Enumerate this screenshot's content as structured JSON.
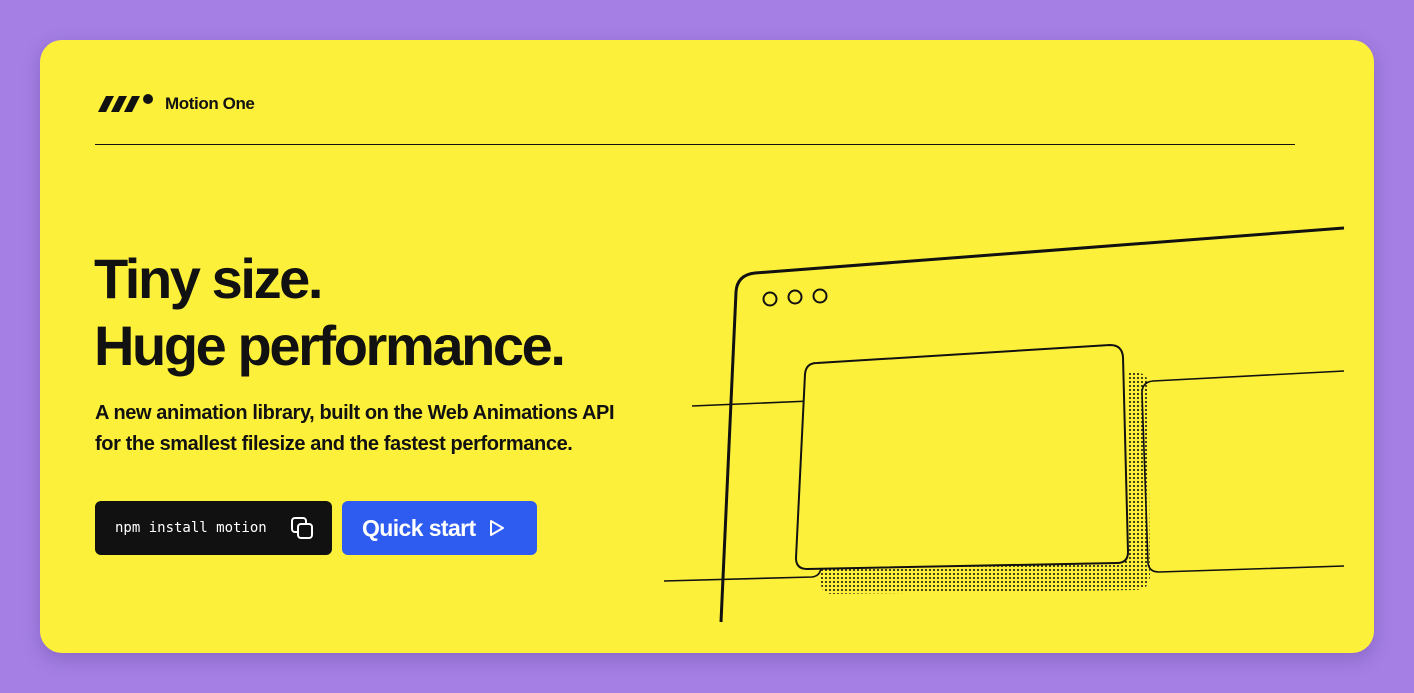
{
  "brand": {
    "name": "Motion One",
    "logo_icon": "motion-one-logo-icon"
  },
  "hero": {
    "headline": [
      "Tiny size.",
      "Huge performance."
    ],
    "subtitle": [
      "A new animation library, built on the Web Animations API",
      "for the smallest filesize and the fastest performance."
    ]
  },
  "install": {
    "command": "npm install motion",
    "copy_icon": "copy-icon"
  },
  "cta": {
    "label": "Quick start",
    "icon": "play-icon"
  },
  "illustration": {
    "description_icon": "browser-windows-illustration-icon"
  },
  "colors": {
    "page_background": "#a57fe4",
    "card_background": "#fdf03a",
    "ink": "#111111",
    "accent": "#2e5bf0"
  }
}
